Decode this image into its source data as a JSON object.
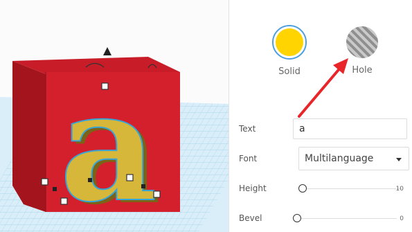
{
  "mode": {
    "solid_label": "Solid",
    "hole_label": "Hole",
    "solid_color": "#ffd400",
    "selected": "solid"
  },
  "properties": {
    "text_label": "Text",
    "text_value": "a",
    "font_label": "Font",
    "font_value": "Multilanguage",
    "height_label": "Height",
    "height_value": "10",
    "bevel_label": "Bevel",
    "bevel_value": "0"
  },
  "scene": {
    "box_color": "#d3202c",
    "letter": "a",
    "letter_color": "#cfb235",
    "grid_color": "#9fcde6"
  },
  "annotation": {
    "arrow_color": "#e8262a",
    "points_to": "hole"
  }
}
